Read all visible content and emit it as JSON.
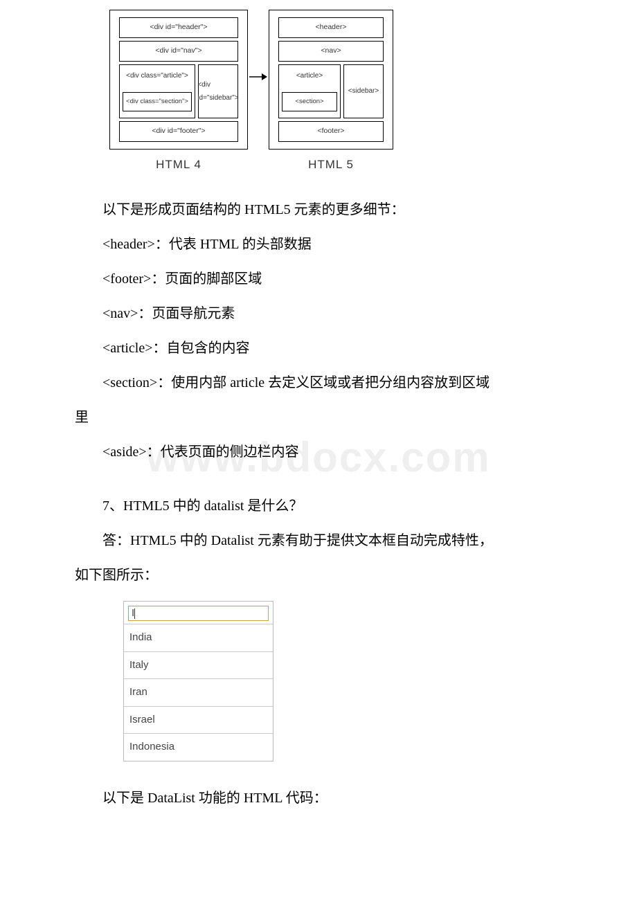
{
  "diagram": {
    "left": {
      "header": "<div id=\"header\">",
      "nav": "<div id=\"nav\">",
      "article": "<div class=\"article\">",
      "section": "<div class=\"section\">",
      "sidebar": "<div id=\"sidebar\">",
      "footer": "<div id=\"footer\">",
      "caption": "HTML 4"
    },
    "right": {
      "header": "<header>",
      "nav": "<nav>",
      "article": "<article>",
      "section": "<section>",
      "sidebar": "<sidebar>",
      "footer": "<footer>",
      "caption": "HTML 5"
    }
  },
  "body": {
    "p1": "以下是形成页面结构的 HTML5 元素的更多细节：",
    "p2": "<header>：代表 HTML 的头部数据",
    "p3": "<footer>：页面的脚部区域",
    "p4": "<nav>：页面导航元素",
    "p5": "<article>：自包含的内容",
    "p6a": "<section>：使用内部 article 去定义区域或者把分组内容放到区域",
    "p6b": "里",
    "p7": "<aside>：代表页面的侧边栏内容",
    "q7": "7、HTML5 中的 datalist 是什么？",
    "a7a": "答：HTML5 中的 Datalist 元素有助于提供文本框自动完成特性，",
    "a7b": "如下图所示：",
    "p8": "以下是 DataList 功能的 HTML 代码："
  },
  "datalist": {
    "input_value": "I",
    "options": [
      "India",
      "Italy",
      "Iran",
      "Israel",
      "Indonesia"
    ]
  },
  "watermark": "www.bdocx.com"
}
